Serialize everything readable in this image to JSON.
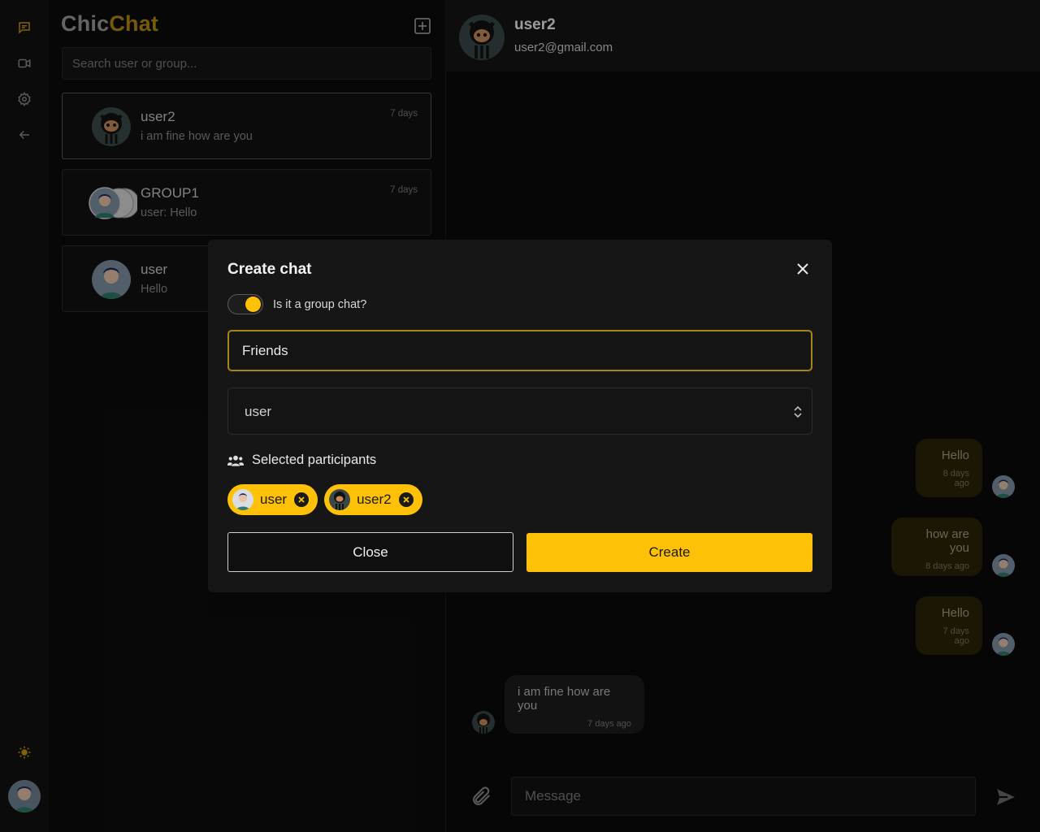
{
  "app": {
    "brand_part1": "Chic",
    "brand_part2": "Chat"
  },
  "rail": {
    "icons": [
      "chat-icon",
      "video-icon",
      "settings-icon",
      "back-arrow-icon",
      "sun-icon",
      "avatar"
    ]
  },
  "search": {
    "placeholder": "Search user or group..."
  },
  "chats": [
    {
      "name": "user2",
      "last": "i am fine how are you",
      "time": "7 days"
    },
    {
      "name": "GROUP1",
      "last": "user: Hello",
      "time": "7 days"
    },
    {
      "name": "user",
      "last": "Hello",
      "time": ""
    }
  ],
  "conversation": {
    "name": "user2",
    "email": "user2@gmail.com",
    "messages": [
      {
        "from": "me",
        "text": "Hello",
        "time": "8 days ago"
      },
      {
        "from": "me",
        "text": "how are you",
        "time": "8 days ago"
      },
      {
        "from": "me",
        "text": "Hello",
        "time": "7 days ago"
      },
      {
        "from": "them",
        "text": "i am fine how are you",
        "time": "7 days ago"
      }
    ],
    "composer_placeholder": "Message"
  },
  "modal": {
    "title": "Create chat",
    "group_toggle_label": "Is it a group chat?",
    "group_toggle_on": true,
    "group_name_value": "Friends",
    "select_value": "user",
    "selected_heading": "Selected participants",
    "participants": [
      "user",
      "user2"
    ],
    "close_label": "Close",
    "create_label": "Create"
  },
  "colors": {
    "accent": "#ffc107",
    "accent_dark": "#b48a12",
    "bubble_me": "#2b2409"
  }
}
